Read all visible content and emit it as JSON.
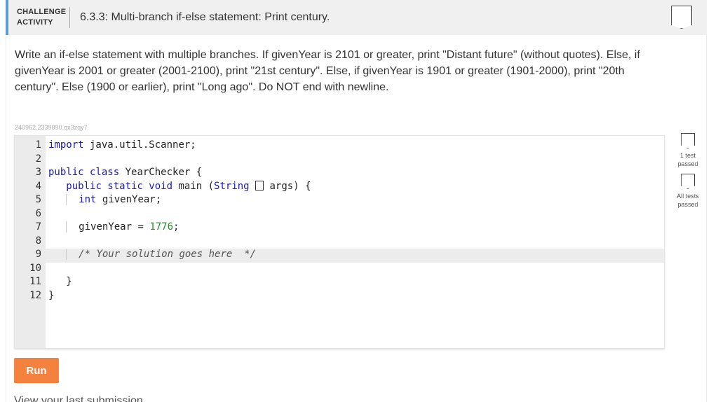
{
  "header": {
    "activity_type": "CHALLENGE ACTIVITY",
    "title": "6.3.3: Multi-branch if-else statement: Print century."
  },
  "instructions": "Write an if-else statement with multiple branches. If givenYear is 2101 or greater, print \"Distant future\" (without quotes). Else, if givenYear is 2001 or greater (2001-2100), print \"21st century\". Else, if givenYear is 1901 or greater (1901-2000), print \"20th century\". Else (1900 or earlier), print \"Long ago\". Do NOT end with newline.",
  "challenge_id": "240962.2339890.qx3zqy7",
  "editor": {
    "line_numbers": [
      "1",
      "2",
      "3",
      "4",
      "5",
      "6",
      "7",
      "8",
      "9",
      "10",
      "11",
      "12"
    ],
    "code": {
      "l1_kw": "import",
      "l1_rest": " java.util.Scanner;",
      "l3_kw": "public class",
      "l3_rest": " YearChecker {",
      "l4_kw1": "public static void",
      "l4_mid": " main (",
      "l4_type": "String",
      "l4_rest": " args) {",
      "l5_kw": "int",
      "l5_rest": " givenYear;",
      "l7_var": "givenYear = ",
      "l7_num": "1776",
      "l7_end": ";",
      "l9_comment": "/* Your solution goes here  */",
      "l11": "}",
      "l12": "}"
    }
  },
  "tests": {
    "first_label": "1 test passed",
    "all_label": "All tests passed"
  },
  "run_label": "Run",
  "submission_link": "View your last submission"
}
